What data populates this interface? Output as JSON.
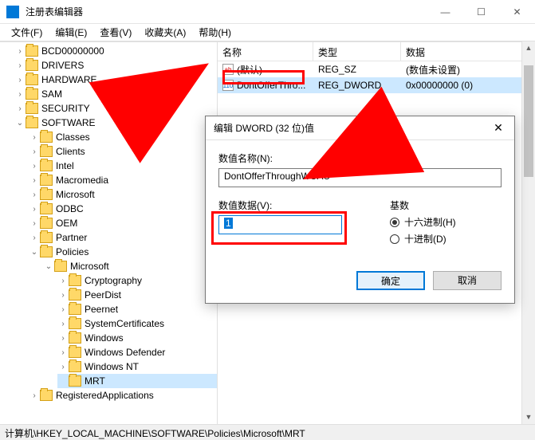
{
  "window": {
    "title": "注册表编辑器"
  },
  "window_controls": {
    "min": "—",
    "max": "☐",
    "close": "✕"
  },
  "menubar": [
    "文件(F)",
    "编辑(E)",
    "查看(V)",
    "收藏夹(A)",
    "帮助(H)"
  ],
  "tree": {
    "items": [
      "BCD00000000",
      "DRIVERS",
      "HARDWARE",
      "SAM",
      "SECURITY",
      "SOFTWARE",
      "Classes",
      "Clients",
      "Intel",
      "Macromedia",
      "Microsoft",
      "ODBC",
      "OEM",
      "Partner",
      "Policies",
      "Microsoft",
      "Cryptography",
      "PeerDist",
      "Peernet",
      "SystemCertificates",
      "Windows",
      "Windows Defender",
      "Windows NT",
      "MRT",
      "RegisteredApplications"
    ]
  },
  "list": {
    "headers": {
      "name": "名称",
      "type": "类型",
      "data": "数据"
    },
    "rows": [
      {
        "icon": "ab",
        "name": "(默认)",
        "type": "REG_SZ",
        "data": "(数值未设置)"
      },
      {
        "icon": "bin",
        "name": "DontOfferThro...",
        "type": "REG_DWORD",
        "data": "0x00000000 (0)"
      }
    ]
  },
  "dialog": {
    "title": "编辑 DWORD (32 位)值",
    "name_label": "数值名称(N):",
    "name_value": "DontOfferThroughWUAU",
    "data_label": "数值数据(V):",
    "data_value": "1",
    "base_label": "基数",
    "radio_hex": "十六进制(H)",
    "radio_dec": "十进制(D)",
    "ok": "确定",
    "cancel": "取消",
    "close": "✕"
  },
  "statusbar": "计算机\\HKEY_LOCAL_MACHINE\\SOFTWARE\\Policies\\Microsoft\\MRT"
}
